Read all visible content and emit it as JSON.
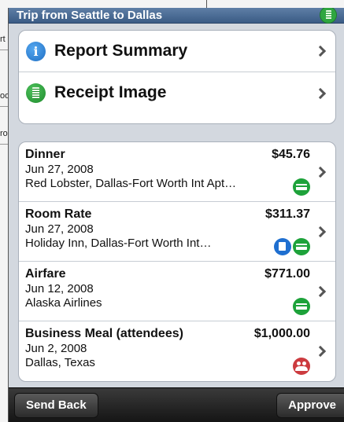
{
  "background": {
    "rows": [
      "rt",
      "oo",
      "ro"
    ]
  },
  "modal": {
    "title": "Trip from Seattle to Dallas",
    "title_icon": "receipt-icon",
    "nav": [
      {
        "label": "Report Summary",
        "icon": "info-icon"
      },
      {
        "label": "Receipt Image",
        "icon": "receipt-icon"
      }
    ],
    "expenses": [
      {
        "name": "Dinner",
        "amount": "$45.76",
        "date": "Jun 27, 2008",
        "place": "Red Lobster, Dallas-Fort Worth Int Apt…",
        "icons": [
          "credit-card-icon"
        ]
      },
      {
        "name": "Room Rate",
        "amount": "$311.37",
        "date": "Jun 27, 2008",
        "place": "Holiday Inn, Dallas-Fort Worth Int…",
        "icons": [
          "document-icon",
          "credit-card-icon"
        ]
      },
      {
        "name": "Airfare",
        "amount": "$771.00",
        "date": "Jun 12, 2008",
        "place": "Alaska Airlines",
        "icons": [
          "credit-card-icon"
        ]
      },
      {
        "name": "Business Meal (attendees)",
        "amount": "$1,000.00",
        "date": "Jun 2, 2008",
        "place": "Dallas, Texas",
        "icons": [
          "attendees-icon"
        ]
      }
    ],
    "toolbar": {
      "send_back_label": "Send Back",
      "approve_label": "Approve"
    }
  },
  "colors": {
    "titlebar": "#4a6b93",
    "card_icon": "#1da23a",
    "doc_icon": "#1f6fd0",
    "attendees_icon": "#cc3b3f",
    "toolbar": "#1f1f1f"
  }
}
